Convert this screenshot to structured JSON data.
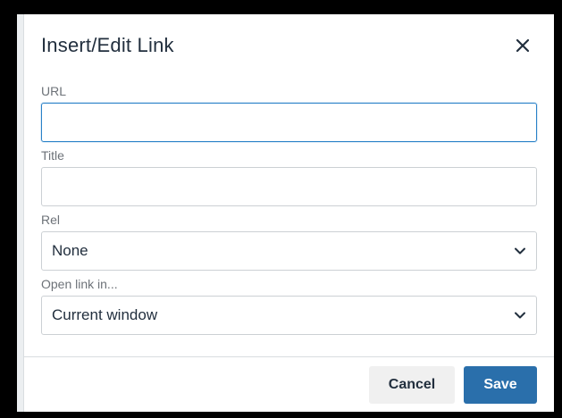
{
  "dialog": {
    "title": "Insert/Edit Link",
    "close_icon": "close-icon"
  },
  "fields": {
    "url": {
      "label": "URL",
      "value": "",
      "placeholder": ""
    },
    "title": {
      "label": "Title",
      "value": "",
      "placeholder": ""
    },
    "rel": {
      "label": "Rel",
      "selected": "None"
    },
    "open_link_in": {
      "label": "Open link in...",
      "selected": "Current window"
    }
  },
  "footer": {
    "cancel_label": "Cancel",
    "save_label": "Save"
  },
  "colors": {
    "accent": "#2a6fab",
    "focus_border": "#2a82c8",
    "text": "#222f3e"
  }
}
